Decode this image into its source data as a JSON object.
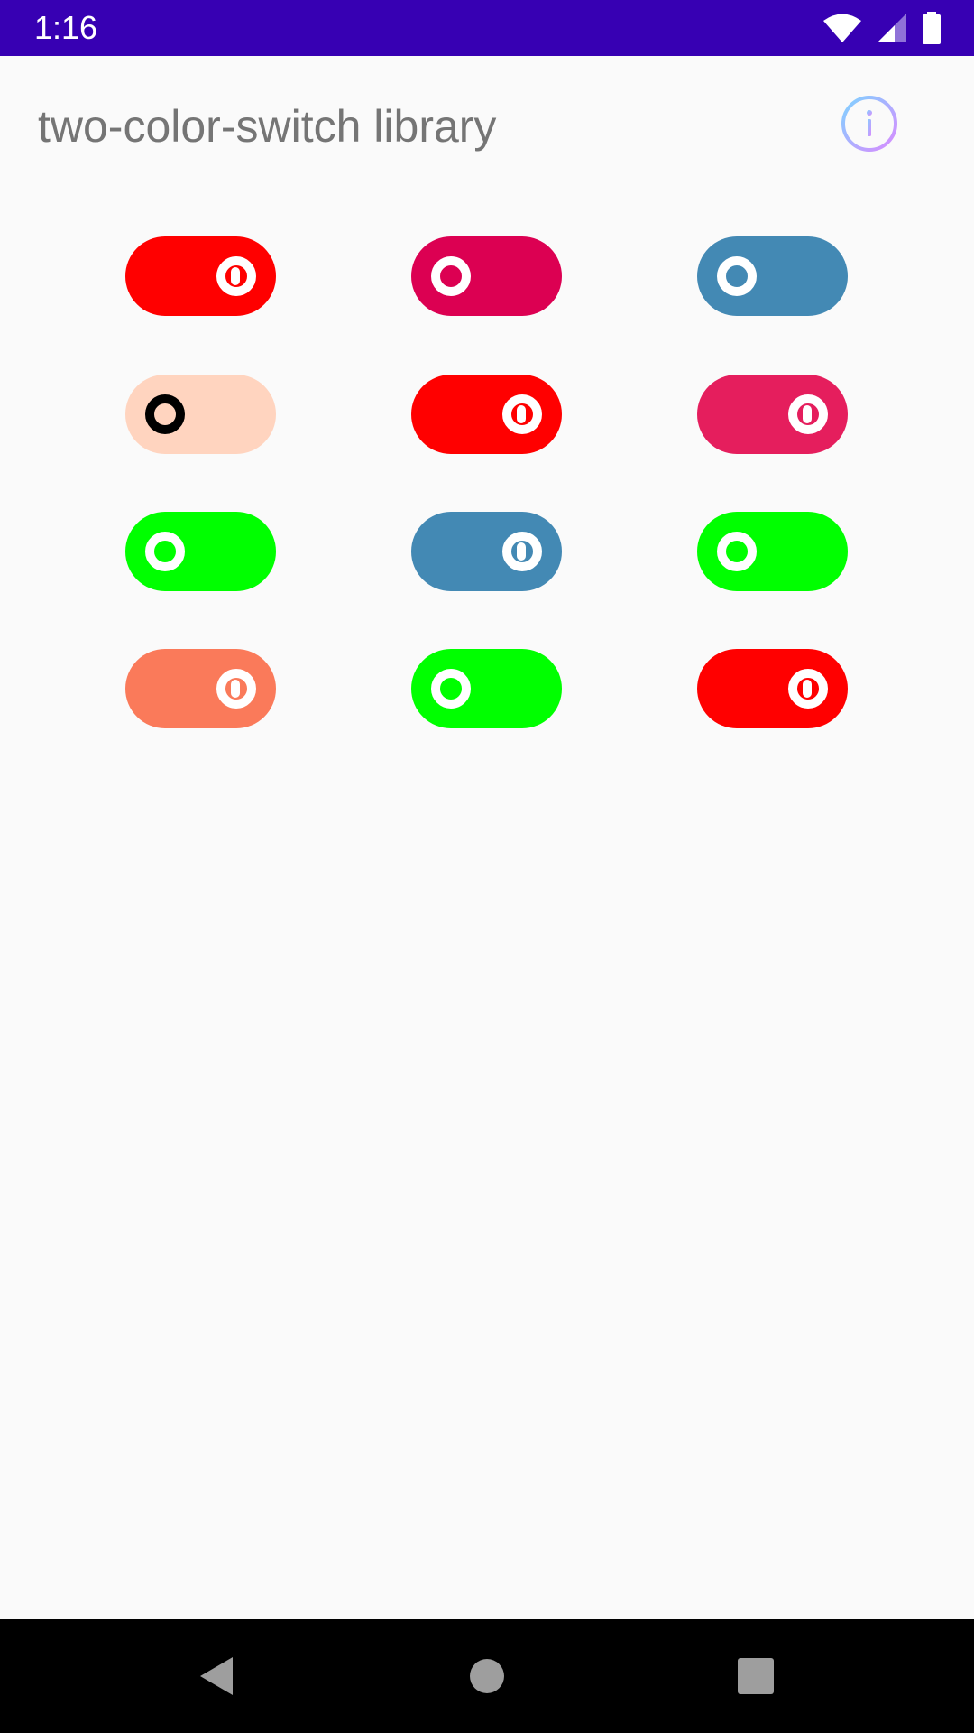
{
  "status_bar": {
    "time": "1:16",
    "icons": [
      "wifi-icon",
      "cell-signal-icon",
      "battery-icon"
    ],
    "background": "#3700B3"
  },
  "header": {
    "title": "two-color-switch library",
    "info_icon": "info-icon"
  },
  "switches": [
    {
      "color": "#FF0000",
      "state": "on"
    },
    {
      "color": "#DC0052",
      "state": "off"
    },
    {
      "color": "#4389B4",
      "state": "off"
    },
    {
      "color": "#FFD4BF",
      "state": "off",
      "knob_color": "#000000"
    },
    {
      "color": "#FF0000",
      "state": "on"
    },
    {
      "color": "#E51E5D",
      "state": "on"
    },
    {
      "color": "#00FF00",
      "state": "off"
    },
    {
      "color": "#4389B4",
      "state": "on"
    },
    {
      "color": "#00FF00",
      "state": "off"
    },
    {
      "color": "#FA7A5A",
      "state": "on"
    },
    {
      "color": "#00FF00",
      "state": "off"
    },
    {
      "color": "#FF0000",
      "state": "on"
    }
  ],
  "nav_bar": {
    "buttons": [
      "back-icon",
      "home-icon",
      "recents-icon"
    ]
  }
}
